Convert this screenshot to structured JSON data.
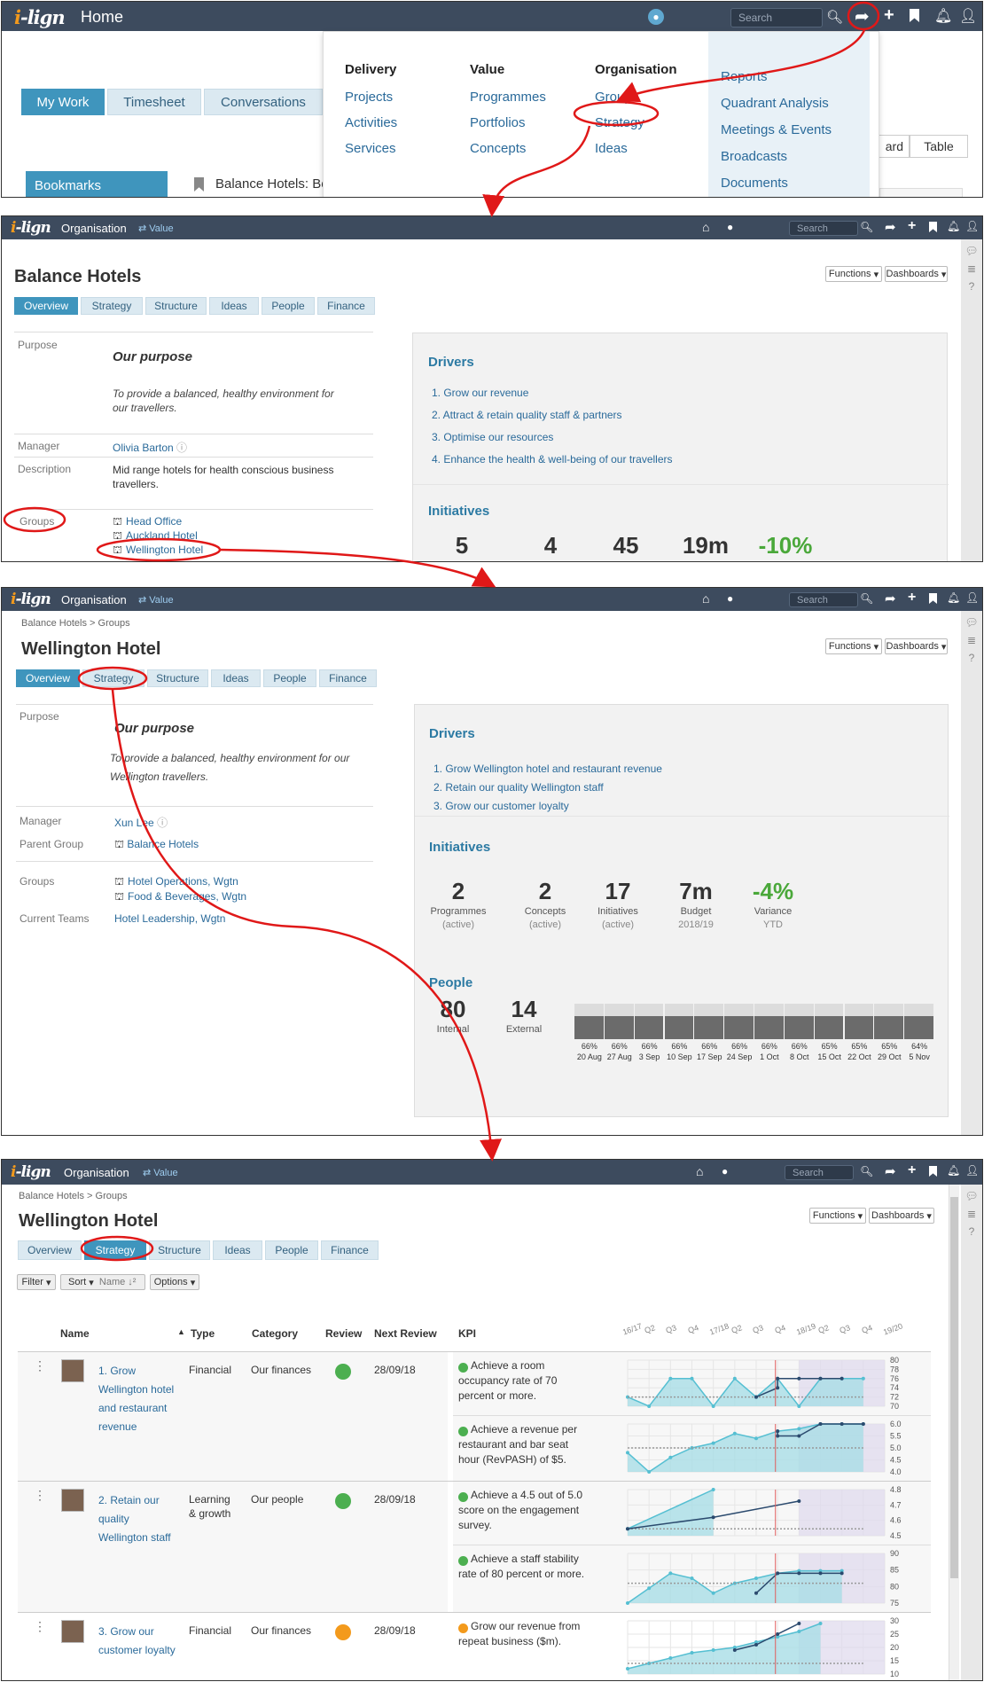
{
  "brand": {
    "logo_main": "i",
    "logo_rest": "-lign",
    "orange": "#f39a1c",
    "navy": "#3d4b5e",
    "accent": "#3f95bd"
  },
  "panel1": {
    "title": "Home",
    "search_placeholder": "Search",
    "tabs": [
      "My Work",
      "Timesheet",
      "Conversations"
    ],
    "bookmarks": "Bookmarks",
    "bookmark_item": "Balance Hotels: Be",
    "view_board": "ard",
    "view_table": "Table",
    "menu": {
      "delivery": {
        "title": "Delivery",
        "items": [
          "Projects",
          "Activities",
          "Services"
        ]
      },
      "value": {
        "title": "Value",
        "items": [
          "Programmes",
          "Portfolios",
          "Concepts"
        ]
      },
      "organisation": {
        "title": "Organisation",
        "items": [
          "Groups",
          "Strategy",
          "Ideas"
        ]
      },
      "right": [
        "Reports",
        "Quadrant Analysis",
        "Meetings & Events",
        "Broadcasts",
        "Documents"
      ]
    }
  },
  "common": {
    "section": "Organisation",
    "value_link": "Value",
    "search": "Search",
    "functions": "Functions",
    "dashboards": "Dashboards",
    "tabs": [
      "Overview",
      "Strategy",
      "Structure",
      "Ideas",
      "People",
      "Finance"
    ]
  },
  "panel2": {
    "title": "Balance Hotels",
    "purpose_label": "Purpose",
    "purpose_heading": "Our purpose",
    "purpose_text": "To provide a balanced, healthy environment for our travellers.",
    "manager_label": "Manager",
    "manager": "Olivia Barton",
    "description_label": "Description",
    "description": "Mid range hotels for health conscious business travellers.",
    "groups_label": "Groups",
    "groups": [
      "Head Office",
      "Auckland Hotel",
      "Wellington Hotel"
    ],
    "drivers_title": "Drivers",
    "drivers": [
      "1. Grow our revenue",
      "2. Attract & retain quality staff & partners",
      "3. Optimise our resources",
      "4. Enhance the health & well-being of our travellers"
    ],
    "initiatives_title": "Initiatives",
    "stats": [
      "5",
      "4",
      "45",
      "19m",
      "-10%"
    ]
  },
  "panel3": {
    "breadcrumb": "Balance Hotels > Groups",
    "title": "Wellington Hotel",
    "purpose_label": "Purpose",
    "purpose_heading": "Our purpose",
    "purpose_text1": "To provide a balanced, healthy environment for our",
    "purpose_text2": "Wellington travellers.",
    "manager_label": "Manager",
    "manager": "Xun Lee",
    "parent_label": "Parent Group",
    "parent": "Balance Hotels",
    "groups_label": "Groups",
    "groups": [
      "Hotel Operations, Wgtn",
      "Food & Beverages, Wgtn"
    ],
    "teams_label": "Current Teams",
    "teams": "Hotel Leadership, Wgtn",
    "drivers_title": "Drivers",
    "drivers": [
      "1. Grow Wellington hotel and restaurant revenue",
      "2. Retain our quality Wellington staff",
      "3. Grow our customer loyalty"
    ],
    "initiatives_title": "Initiatives",
    "stats": [
      {
        "n": "2",
        "l1": "Programmes",
        "l2": "(active)"
      },
      {
        "n": "2",
        "l1": "Concepts",
        "l2": "(active)"
      },
      {
        "n": "17",
        "l1": "Initiatives",
        "l2": "(active)"
      },
      {
        "n": "7m",
        "l1": "Budget",
        "l2": "2018/19"
      },
      {
        "n": "-4%",
        "l1": "Variance",
        "l2": "YTD"
      }
    ],
    "people_title": "People",
    "people": [
      {
        "n": "80",
        "l": "Internal"
      },
      {
        "n": "14",
        "l": "External"
      }
    ],
    "bar_pcts": [
      "66%",
      "66%",
      "66%",
      "66%",
      "66%",
      "66%",
      "66%",
      "66%",
      "65%",
      "65%",
      "65%",
      "64%"
    ],
    "bar_fill": [
      0.66,
      0.66,
      0.66,
      0.66,
      0.66,
      0.66,
      0.66,
      0.66,
      0.65,
      0.65,
      0.65,
      0.64
    ],
    "bar_dates": [
      "20 Aug",
      "27 Aug",
      "3 Sep",
      "10 Sep",
      "17 Sep",
      "24 Sep",
      "1 Oct",
      "8 Oct",
      "15 Oct",
      "22 Oct",
      "29 Oct",
      "5 Nov"
    ]
  },
  "panel4": {
    "breadcrumb": "Balance Hotels > Groups",
    "title": "Wellington Hotel",
    "filter": "Filter",
    "sort": "Sort",
    "sort_name": "Name",
    "options": "Options",
    "headers": {
      "name": "Name",
      "type": "Type",
      "category": "Category",
      "review": "Review",
      "next_review": "Next Review",
      "kpi": "KPI"
    },
    "quarters": [
      "16/17",
      "Q2",
      "Q3",
      "Q4",
      "17/18",
      "Q2",
      "Q3",
      "Q4",
      "18/19",
      "Q2",
      "Q3",
      "Q4",
      "19/20"
    ],
    "rows": [
      {
        "name_lines": [
          "1. Grow",
          "Wellington hotel",
          "and restaurant",
          "revenue"
        ],
        "type": "Financial",
        "category": "Our finances",
        "status": "#4caf50",
        "next": "28/09/18",
        "kpis": [
          {
            "lines": [
              "Achieve a room",
              "occupancy rate of 70",
              "percent or more."
            ],
            "status": "#4caf50",
            "ticks": [
              "80",
              "78",
              "76",
              "74",
              "72",
              "70"
            ],
            "series": [
              [
                0,
                0.2
              ],
              [
                1,
                0.0
              ],
              [
                2,
                0.6
              ],
              [
                3,
                0.6
              ],
              [
                4,
                0.0
              ],
              [
                5,
                0.6
              ],
              [
                6,
                0.2
              ],
              [
                7,
                0.6
              ],
              [
                8,
                0.0
              ],
              [
                9,
                0.6
              ],
              [
                10,
                0.6
              ],
              [
                11,
                0.6
              ]
            ],
            "actual": [
              [
                6,
                0.2
              ],
              [
                7,
                0.4
              ],
              [
                7,
                0.6
              ],
              [
                8,
                0.6
              ],
              [
                9,
                0.6
              ],
              [
                10,
                0.6
              ]
            ],
            "target": 0.2
          },
          {
            "lines": [
              "Achieve a revenue per",
              "restaurant and bar seat",
              "hour (RevPASH) of $5."
            ],
            "status": "#4caf50",
            "ticks": [
              "6.0",
              "5.5",
              "5.0",
              "4.5",
              "4.0"
            ],
            "series": [
              [
                0,
                0.4
              ],
              [
                1,
                0.0
              ],
              [
                2,
                0.3
              ],
              [
                3,
                0.5
              ],
              [
                4,
                0.6
              ],
              [
                5,
                0.8
              ],
              [
                6,
                0.7
              ],
              [
                7,
                0.85
              ],
              [
                8,
                0.9
              ],
              [
                9,
                1.0
              ],
              [
                10,
                1.0
              ],
              [
                11,
                1.0
              ]
            ],
            "actual": [
              [
                7,
                0.85
              ],
              [
                7,
                0.75
              ],
              [
                8,
                0.75
              ],
              [
                9,
                1.0
              ],
              [
                10,
                1.0
              ],
              [
                11,
                1.0
              ]
            ],
            "target": 0.5
          }
        ]
      },
      {
        "name_lines": [
          "2. Retain our",
          "quality",
          "Wellington staff"
        ],
        "type": "Learning",
        "type2": "& growth",
        "category": "Our people",
        "status": "#4caf50",
        "next": "28/09/18",
        "kpis": [
          {
            "lines": [
              "Achieve a 4.5 out of 5.0",
              "score on the engagement",
              "survey."
            ],
            "status": "#4caf50",
            "ticks": [
              "4.8",
              "4.7",
              "4.6",
              "4.5"
            ],
            "series": [
              [
                0,
                0.15
              ],
              [
                4,
                1.0
              ]
            ],
            "actual": [
              [
                0,
                0.15
              ],
              [
                4,
                0.4
              ],
              [
                8,
                0.75
              ]
            ],
            "target": 0.15
          },
          {
            "lines": [
              "Achieve a staff stability",
              "rate of 80 percent or more."
            ],
            "status": "#4caf50",
            "ticks": [
              "90",
              "85",
              "80",
              "75"
            ],
            "series": [
              [
                0,
                0.0
              ],
              [
                1,
                0.3
              ],
              [
                2,
                0.6
              ],
              [
                3,
                0.5
              ],
              [
                4,
                0.2
              ],
              [
                5,
                0.4
              ],
              [
                6,
                0.5
              ],
              [
                7,
                0.6
              ],
              [
                8,
                0.65
              ],
              [
                9,
                0.65
              ],
              [
                10,
                0.65
              ]
            ],
            "actual": [
              [
                6,
                0.2
              ],
              [
                7,
                0.6
              ],
              [
                8,
                0.6
              ],
              [
                9,
                0.6
              ],
              [
                10,
                0.6
              ]
            ],
            "target": 0.4
          }
        ]
      },
      {
        "name_lines": [
          "3. Grow our",
          "customer loyalty"
        ],
        "type": "Financial",
        "category": "Our finances",
        "status": "#f39a1c",
        "next": "28/09/18",
        "kpis": [
          {
            "lines": [
              "Grow our revenue from",
              "repeat business ($m)."
            ],
            "status": "#f39a1c",
            "ticks": [
              "30",
              "25",
              "20",
              "15",
              "10"
            ],
            "series": [
              [
                0,
                0.1
              ],
              [
                1,
                0.2
              ],
              [
                2,
                0.3
              ],
              [
                3,
                0.4
              ],
              [
                4,
                0.45
              ],
              [
                5,
                0.5
              ],
              [
                6,
                0.6
              ],
              [
                7,
                0.7
              ],
              [
                8,
                0.8
              ],
              [
                9,
                0.95
              ]
            ],
            "actual": [
              [
                5,
                0.45
              ],
              [
                6,
                0.55
              ],
              [
                7,
                0.75
              ],
              [
                8,
                0.95
              ]
            ],
            "target": 0.2
          }
        ]
      }
    ]
  }
}
